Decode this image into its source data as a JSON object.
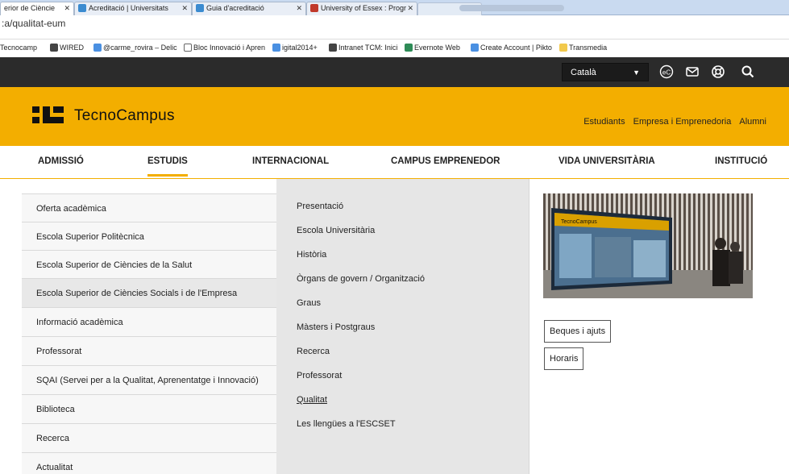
{
  "browser": {
    "tabs": [
      {
        "label": "erior de Cièncie",
        "active": true
      },
      {
        "label": "Acreditació | Universitats",
        "active": false
      },
      {
        "label": "Guia d'acreditació",
        "active": false
      },
      {
        "label": "University of Essex : Progr",
        "active": false
      }
    ],
    "url": ":a/qualitat-eum",
    "bookmarks": [
      "Tecnocamp",
      "WIRED",
      "@carme_rovira – Delic",
      "Bloc Innovació i Apren",
      "igital2014+",
      "Intranet TCM: Inici",
      "Evernote Web",
      "Create Account | Pikto",
      "Transmedia"
    ]
  },
  "topbar": {
    "language": "Català",
    "icons": [
      "creative-commons-icon",
      "mail-icon",
      "help-icon",
      "search-icon"
    ],
    "cc_glyph": "eC"
  },
  "header": {
    "logo_text": "TecnoCampus",
    "links": [
      "Estudiants",
      "Empresa i Emprenedoria",
      "Alumni"
    ]
  },
  "nav": {
    "items": [
      "ADMISSIÓ",
      "ESTUDIS",
      "INTERNACIONAL",
      "CAMPUS EMPRENEDOR",
      "VIDA UNIVERSITÀRIA",
      "INSTITUCIÓ"
    ],
    "active": "ESTUDIS"
  },
  "menu": {
    "col1": [
      "Oferta acadèmica",
      "Escola Superior Politècnica",
      "Escola Superior de Ciències de la Salut",
      "Escola Superior de Ciències Socials i de l'Empresa",
      "Informació acadèmica",
      "Professorat",
      "SQAI (Servei per a la Qualitat, Aprenentatge i Innovació)",
      "Biblioteca",
      "Recerca",
      "Actualitat"
    ],
    "col2": [
      "Presentació",
      "Escola Universitària",
      "Història",
      "Òrgans de govern / Organització",
      "Graus",
      "Màsters i Postgraus",
      "Recerca",
      "Professorat",
      "Qualitat",
      "Les llengües a l'ESCSET"
    ],
    "photo_screen_text": "TecnoCampus",
    "buttons": [
      "Beques i ajuts",
      "Horaris"
    ]
  }
}
